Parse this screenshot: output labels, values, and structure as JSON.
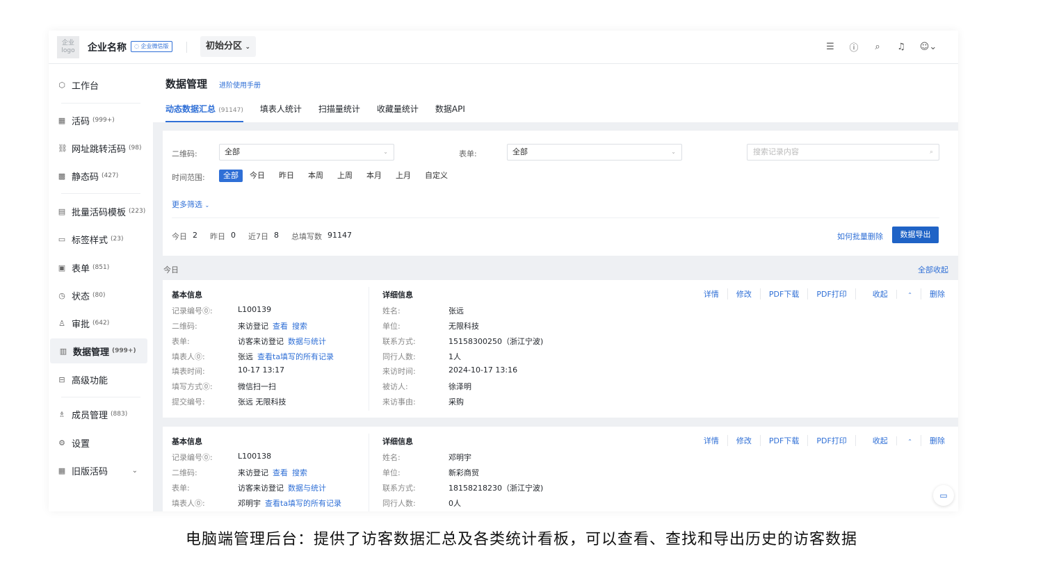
{
  "topbar": {
    "logo_text": "企业 logo",
    "company": "企业名称",
    "badge": "企业微信版",
    "zone": "初始分区",
    "icons": [
      "menu-icon",
      "help-icon",
      "search-icon",
      "bell-icon",
      "user-icon"
    ]
  },
  "sidebar": {
    "items": [
      {
        "label": "工作台",
        "count": ""
      },
      {
        "label": "活码",
        "count": "(999+)"
      },
      {
        "label": "网址跳转活码",
        "count": "(98)"
      },
      {
        "label": "静态码",
        "count": "(427)"
      },
      {
        "label": "批量活码模板",
        "count": "(223)"
      },
      {
        "label": "标签样式",
        "count": "(23)"
      },
      {
        "label": "表单",
        "count": "(851)"
      },
      {
        "label": "状态",
        "count": "(80)"
      },
      {
        "label": "审批",
        "count": "(642)"
      },
      {
        "label": "数据管理",
        "count": "(999+)"
      },
      {
        "label": "高级功能",
        "count": ""
      },
      {
        "label": "成员管理",
        "count": "(883)"
      },
      {
        "label": "设置",
        "count": ""
      },
      {
        "label": "旧版活码",
        "count": ""
      }
    ]
  },
  "header": {
    "title": "数据管理",
    "manual_link": "进阶使用手册",
    "tabs": [
      {
        "label": "动态数据汇总",
        "count": "(91147)"
      },
      {
        "label": "填表人统计"
      },
      {
        "label": "扫描量统计"
      },
      {
        "label": "收藏量统计"
      },
      {
        "label": "数据API"
      }
    ]
  },
  "filters": {
    "qrcode_label": "二维码:",
    "qrcode_value": "全部",
    "form_label": "表单:",
    "form_value": "全部",
    "search_placeholder": "搜索记录内容",
    "time_label": "时间范围:",
    "time_options": [
      "全部",
      "今日",
      "昨日",
      "本周",
      "上周",
      "本月",
      "上月",
      "自定义"
    ],
    "more_filters": "更多筛选",
    "stats": [
      {
        "label": "今日",
        "value": "2"
      },
      {
        "label": "昨日",
        "value": "0"
      },
      {
        "label": "近7日",
        "value": "8"
      },
      {
        "label": "总填写数",
        "value": "91147"
      }
    ],
    "how_to_delete": "如何批量删除",
    "export": "数据导出"
  },
  "section": {
    "today": "今日",
    "collapse_all": "全部收起"
  },
  "actions": [
    "详情",
    "修改",
    "PDF下载",
    "PDF打印",
    "收起",
    "删除"
  ],
  "records": [
    {
      "basic_title": "基本信息",
      "detail_title": "详细信息",
      "basic": [
        {
          "k": "记录编号⓪:",
          "v": "L100139",
          "links": []
        },
        {
          "k": "二维码:",
          "v": "来访登记",
          "links": [
            "查看",
            "搜索"
          ]
        },
        {
          "k": "表单:",
          "v": "访客来访登记",
          "links": [
            "数据与统计"
          ]
        },
        {
          "k": "填表人⓪:",
          "v": "张远",
          "links": [
            "查看ta填写的所有记录"
          ]
        },
        {
          "k": "填表时间:",
          "v": "10-17 13:17",
          "links": []
        },
        {
          "k": "填写方式⓪:",
          "v": "微信扫一扫",
          "links": []
        },
        {
          "k": "提交编号:",
          "v": "张远 无限科技",
          "links": []
        }
      ],
      "detail": [
        {
          "k": "姓名:",
          "v": "张远"
        },
        {
          "k": "单位:",
          "v": "无限科技"
        },
        {
          "k": "联系方式:",
          "v": "15158300250（浙江宁波)"
        },
        {
          "k": "同行人数:",
          "v": "1人"
        },
        {
          "k": "来访时间:",
          "v": "2024-10-17 13:16"
        },
        {
          "k": "被访人:",
          "v": "徐泽明"
        },
        {
          "k": "来访事由:",
          "v": "采购"
        }
      ]
    },
    {
      "basic_title": "基本信息",
      "detail_title": "详细信息",
      "basic": [
        {
          "k": "记录编号⓪:",
          "v": "L100138",
          "links": []
        },
        {
          "k": "二维码:",
          "v": "来访登记",
          "links": [
            "查看",
            "搜索"
          ]
        },
        {
          "k": "表单:",
          "v": "访客来访登记",
          "links": [
            "数据与统计"
          ]
        },
        {
          "k": "填表人⓪:",
          "v": "邓明宇",
          "links": [
            "查看ta填写的所有记录"
          ]
        }
      ],
      "detail": [
        {
          "k": "姓名:",
          "v": "邓明宇"
        },
        {
          "k": "单位:",
          "v": "新彩商贸"
        },
        {
          "k": "联系方式:",
          "v": "18158218230（浙江宁波)"
        },
        {
          "k": "同行人数:",
          "v": "0人"
        }
      ]
    }
  ],
  "caption": "电脑端管理后台：提供了访客数据汇总及各类统计看板，可以查看、查找和导出历史的访客数据",
  "colors": {
    "accent": "#2f6fd6",
    "button": "#1f63c6",
    "background": "#eef0f3"
  }
}
